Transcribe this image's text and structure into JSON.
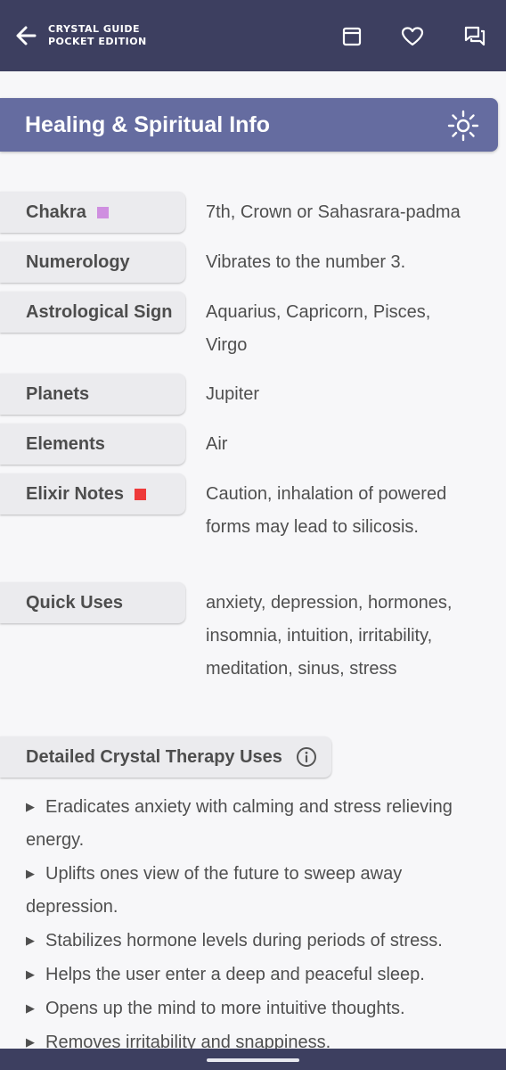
{
  "app": {
    "title_line1": "CRYSTAL GUIDE",
    "title_line2": "POCKET EDITION"
  },
  "toolbar": {
    "icons": [
      "back-arrow-icon",
      "calendar-icon",
      "heart-icon",
      "chat-icon"
    ]
  },
  "section": {
    "title": "Healing & Spiritual Info",
    "icon": "sun-icon"
  },
  "rows": [
    {
      "label": "Chakra",
      "value": "7th, Crown or Sahasrara-padma",
      "swatch": "#cf8fe0"
    },
    {
      "label": "Numerology",
      "value": "Vibrates to the number 3."
    },
    {
      "label": "Astrological Sign",
      "value": "Aquarius, Capricorn, Pisces, Virgo"
    },
    {
      "label": "Planets",
      "value": "Jupiter"
    },
    {
      "label": "Elements",
      "value": "Air"
    },
    {
      "label": "Elixir Notes",
      "value": "Caution, inhalation of powered forms may lead to silicosis.",
      "swatch": "#ee3a3a"
    },
    {
      "label": "Quick Uses",
      "value": "anxiety, depression, hormones, insomnia, intuition, irritability, meditation, sinus, stress"
    }
  ],
  "detailed": {
    "title": "Detailed Crystal Therapy Uses",
    "icon": "info-icon",
    "items": [
      "Eradicates anxiety with calming and stress relieving energy.",
      "Uplifts ones view of the future to sweep away depression.",
      "Stabilizes hormone levels during periods of stress.",
      "Helps the user enter a deep and peaceful sleep.",
      "Opens up the mind to more intuitive thoughts.",
      "Removes irritability and snappiness."
    ]
  },
  "colors": {
    "topbar": "#3d3f60",
    "section_header": "#656ca0",
    "background": "#f7f7f9",
    "pill": "#ebebee"
  }
}
